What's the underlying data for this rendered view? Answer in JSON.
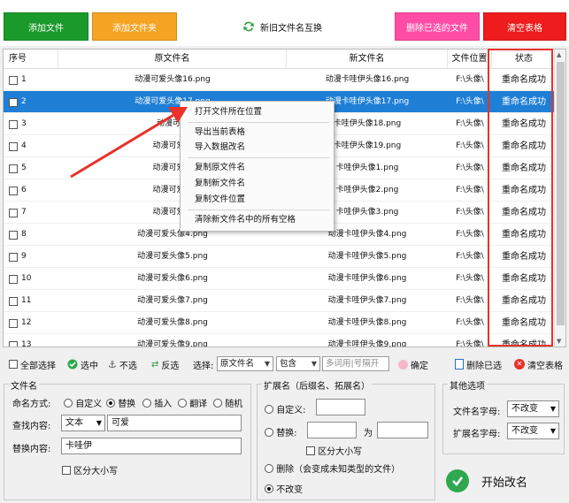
{
  "toolbar": {
    "add_file": "添加文件",
    "add_folder": "添加文件夹",
    "swap_names": "新旧文件名互换",
    "delete_selected": "删除已选的文件",
    "clear_table": "清空表格"
  },
  "colors": {
    "add_file": "#1a9a2a",
    "add_folder": "#f5a424",
    "delete_selected": "#ff4da6",
    "clear_table": "#ee1c1c",
    "selection": "#1f7fd6",
    "highlight": "#e8322a"
  },
  "table": {
    "headers": [
      "序号",
      "原文件名",
      "新文件名",
      "文件位置",
      "状态"
    ],
    "rows": [
      {
        "no": "1",
        "old": "动漫可爱头像16.png",
        "new": "动漫卡哇伊头像16.png",
        "loc": "F:\\头像\\",
        "status": "重命名成功"
      },
      {
        "no": "2",
        "old": "动漫可爱头像17.png",
        "new": "动漫卡哇伊头像17.png",
        "loc": "F:\\头像\\",
        "status": "重命名成功"
      },
      {
        "no": "3",
        "old": "动漫可爱",
        "new": "卡哇伊头像18.png",
        "loc": "F:\\头像\\",
        "status": "重命名成功"
      },
      {
        "no": "4",
        "old": "动漫可爱头",
        "new": "卡哇伊头像19.png",
        "loc": "F:\\头像\\",
        "status": "重命名成功"
      },
      {
        "no": "5",
        "old": "动漫可爱头",
        "new": "卡哇伊头像1.png",
        "loc": "F:\\头像\\",
        "status": "重命名成功"
      },
      {
        "no": "6",
        "old": "动漫可爱头",
        "new": "卡哇伊头像2.png",
        "loc": "F:\\头像\\",
        "status": "重命名成功"
      },
      {
        "no": "7",
        "old": "动漫可爱头",
        "new": "卡哇伊头像3.png",
        "loc": "F:\\头像\\",
        "status": "重命名成功"
      },
      {
        "no": "8",
        "old": "动漫可爱头像4.png",
        "new": "动漫卡哇伊头像4.png",
        "loc": "F:\\头像\\",
        "status": "重命名成功"
      },
      {
        "no": "9",
        "old": "动漫可爱头像5.png",
        "new": "动漫卡哇伊头像5.png",
        "loc": "F:\\头像\\",
        "status": "重命名成功"
      },
      {
        "no": "10",
        "old": "动漫可爱头像6.png",
        "new": "动漫卡哇伊头像6.png",
        "loc": "F:\\头像\\",
        "status": "重命名成功"
      },
      {
        "no": "11",
        "old": "动漫可爱头像7.png",
        "new": "动漫卡哇伊头像7.png",
        "loc": "F:\\头像\\",
        "status": "重命名成功"
      },
      {
        "no": "12",
        "old": "动漫可爱头像8.png",
        "new": "动漫卡哇伊头像8.png",
        "loc": "F:\\头像\\",
        "status": "重命名成功"
      },
      {
        "no": "13",
        "old": "动漫可爱头像9.png",
        "new": "动漫卡哇伊头像9.png",
        "loc": "F:\\头像\\",
        "status": "重命名成功"
      }
    ],
    "selected_row": 2
  },
  "context_menu": {
    "items": [
      "打开文件所在位置",
      "导出当前表格",
      "导入数据改名",
      "复制原文件名",
      "复制新文件名",
      "复制文件位置",
      "清除新文件名中的所有空格"
    ]
  },
  "actions": {
    "select_all": "全部选择",
    "select": "选中",
    "deselect": "不选",
    "invert": "反选",
    "choose": "选择:",
    "field_select": "原文件名",
    "match_select": "包含",
    "keyword_placeholder": "多词用|号隔开",
    "confirm": "确定",
    "delete_selected": "删除已选",
    "clear_table": "清空表格"
  },
  "filename_panel": {
    "title": "文件名",
    "mode_label": "命名方式:",
    "modes": [
      "自定义",
      "替换",
      "插入",
      "翻译",
      "随机"
    ],
    "mode_selected": "替换",
    "find_label": "查找内容:",
    "find_type": "文本",
    "find_value": "可爱",
    "replace_label": "替换内容:",
    "replace_value": "卡哇伊",
    "case_sensitive": "区分大小写"
  },
  "extension_panel": {
    "title": "扩展名（后缀名、拓展名）",
    "custom": "自定义:",
    "replace": "替换:",
    "to": "为",
    "case_sensitive": "区分大小写",
    "delete": "删除（会变成未知类型的文件）",
    "unchanged": "不改变",
    "selected": "不改变"
  },
  "other_panel": {
    "title": "其他选项",
    "filename_case_label": "文件名字母:",
    "filename_case_value": "不改变",
    "ext_case_label": "扩展名字母:",
    "ext_case_value": "不改变"
  },
  "start_button": "开始改名"
}
